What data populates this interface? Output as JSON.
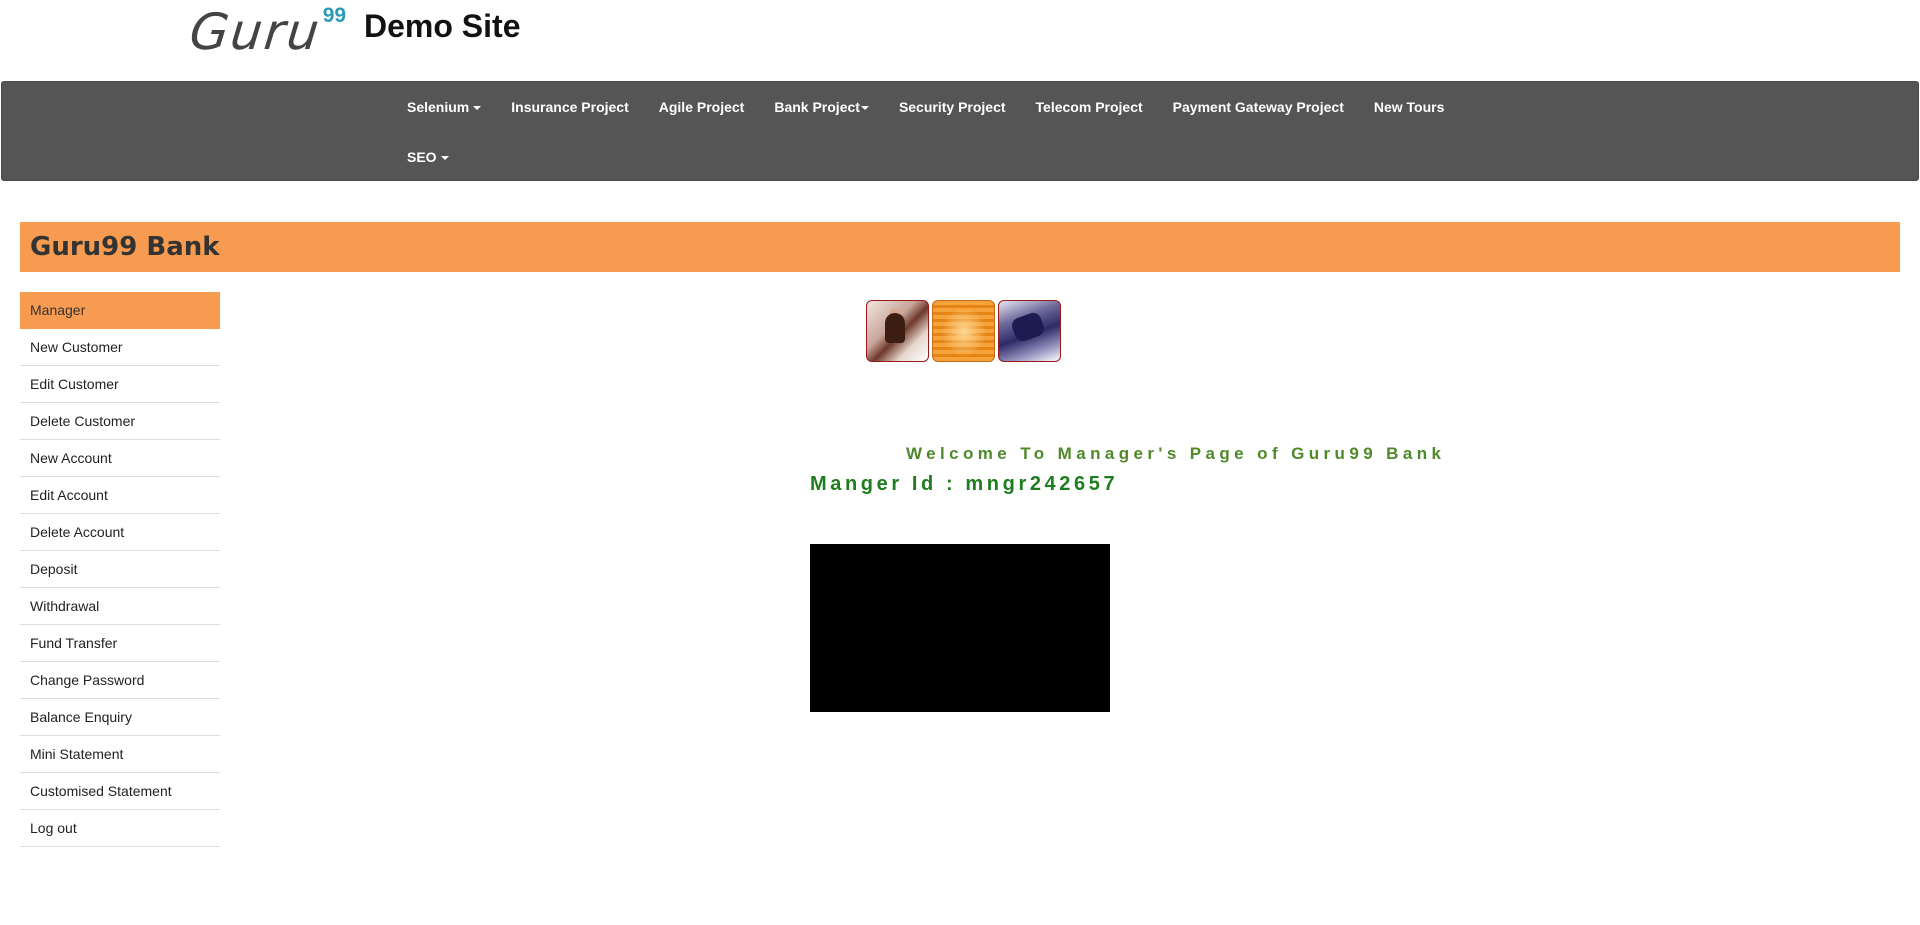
{
  "header": {
    "logo_text": "Guru",
    "logo_sup": "99",
    "site_title": "Demo Site"
  },
  "navbar": {
    "row1": [
      {
        "label": "Selenium",
        "dropdown": true
      },
      {
        "label": "Insurance Project",
        "dropdown": false
      },
      {
        "label": "Agile Project",
        "dropdown": false
      },
      {
        "label": "Bank Project",
        "dropdown": true
      },
      {
        "label": "Security Project",
        "dropdown": false
      },
      {
        "label": "Telecom Project",
        "dropdown": false
      },
      {
        "label": "Payment Gateway Project",
        "dropdown": false
      },
      {
        "label": "New Tours",
        "dropdown": false
      }
    ],
    "row2": [
      {
        "label": "SEO",
        "dropdown": true
      }
    ]
  },
  "banner": {
    "title": "Guru99 Bank"
  },
  "menu": {
    "items": [
      {
        "label": "Manager",
        "active": true
      },
      {
        "label": "New Customer"
      },
      {
        "label": "Edit Customer"
      },
      {
        "label": "Delete Customer"
      },
      {
        "label": "New Account"
      },
      {
        "label": "Edit Account"
      },
      {
        "label": "Delete Account"
      },
      {
        "label": "Deposit"
      },
      {
        "label": "Withdrawal"
      },
      {
        "label": "Fund Transfer"
      },
      {
        "label": "Change Password"
      },
      {
        "label": "Balance Enquiry"
      },
      {
        "label": "Mini Statement"
      },
      {
        "label": "Customised Statement"
      },
      {
        "label": "Log out"
      }
    ]
  },
  "main": {
    "welcome_text": "Welcome To Manager's Page of Guru99 Bank",
    "manager_id_text": "Manger Id : mngr242657"
  },
  "colors": {
    "navbar_bg": "#555555",
    "accent_orange": "#f79b50",
    "welcome_green": "#4f8a2a",
    "manager_id_green": "#1e7d1e",
    "logo_sup_blue": "#2b9ab8"
  }
}
